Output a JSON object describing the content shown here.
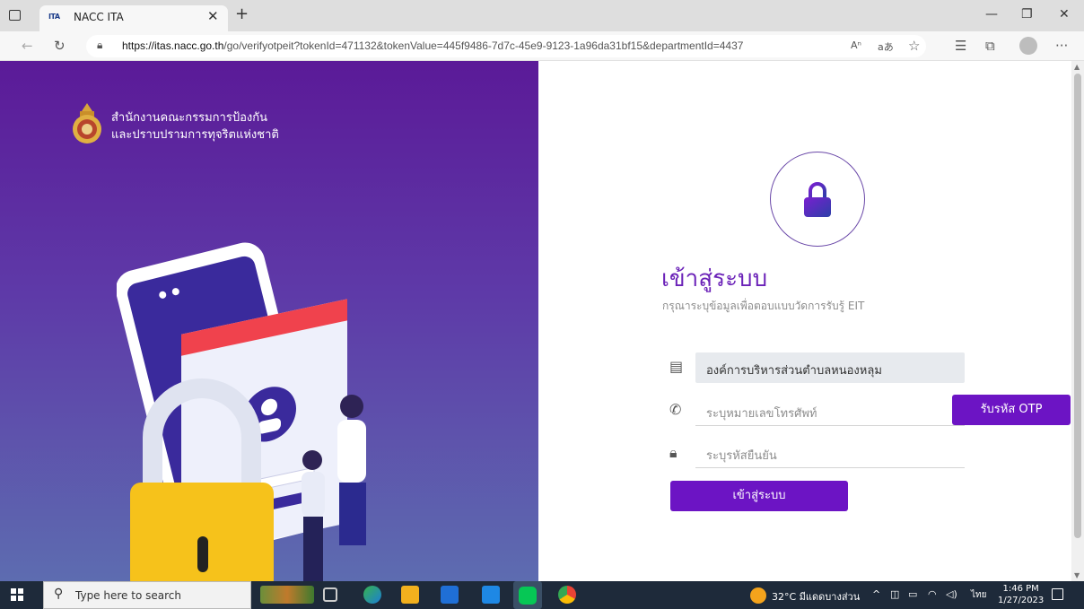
{
  "browser": {
    "tab_title": "NACC ITA",
    "tab_favicon_text": "ITA",
    "url_domain": "https://itas.nacc.go.th",
    "url_path": "/go/verifyotpeit?tokenId=471132&tokenValue=445f9486-7d7c-45e9-9123-1a96da31bf15&departmentId=4437",
    "toolbar_text_a": "Aⁿ",
    "toolbar_text_b": "aあ"
  },
  "brand": {
    "org_name_line1": "สำนักงานคณะกรรมการป้องกัน",
    "org_name_line2": "และปราบปรามการทุจริตแห่งชาติ"
  },
  "login": {
    "heading": "เข้าสู่ระบบ",
    "subheading": "กรุณาระบุข้อมูลเพื่อตอบแบบวัดการรับรู้ EIT",
    "department_value": "องค์การบริหารส่วนตำบลหนองหลุม",
    "phone_placeholder": "ระบุหมายเลขโทรศัพท์",
    "otp_button": "รับรหัส OTP",
    "code_placeholder": "ระบุรหัสยืนยัน",
    "submit_button": "เข้าสู่ระบบ"
  },
  "taskbar": {
    "search_placeholder": "Type here to search",
    "weather": "32°C มีแดดบางส่วน",
    "language": "ไทย",
    "time": "1:46 PM",
    "date": "1/27/2023"
  },
  "colors": {
    "accent": "#6c14c4",
    "panel_top": "#5b1a98",
    "panel_bottom": "#5d6cb0"
  }
}
